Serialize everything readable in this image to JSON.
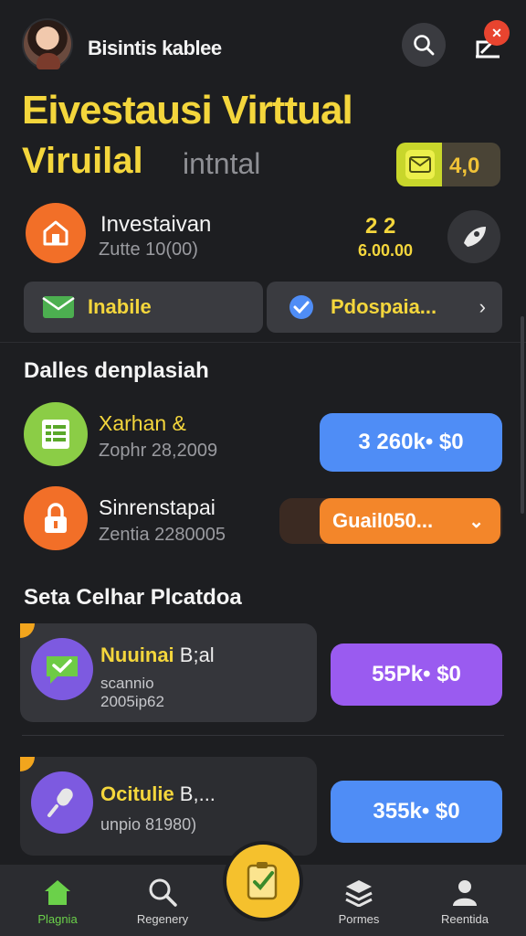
{
  "header": {
    "account_name": "Bisintis kablee",
    "notification_badge": "✕"
  },
  "hero": {
    "title_line1": "Eivestausi  Virttual",
    "title_line2": "Viruilal",
    "title_line2_sub": "intntal",
    "balance_value": "4,0"
  },
  "investment": {
    "title": "Investaivan",
    "subtitle": "Zutte 10(00)",
    "value_top": "2 2",
    "value_bottom": "6.00.00"
  },
  "quick_actions": {
    "left_label": "Inabile",
    "right_label": "Pdospaia..."
  },
  "section1": {
    "title": "Dalles denplasiah",
    "rows": [
      {
        "name": "Xarhan &",
        "sub": "Zophr 28,2009",
        "button": "3  260k•  $0"
      },
      {
        "name": "Sinrenstapai",
        "sub": "Zentia 2280005",
        "button": "Guail050..."
      }
    ]
  },
  "section2": {
    "title": "Seta Celhar Plcatdoa",
    "cards": [
      {
        "name": "Nuuinai",
        "name_tail": " B;al",
        "sub1": "scannio",
        "sub2": "2005ip62",
        "button": "55Pk•  $0"
      },
      {
        "name": "Ocitulie",
        "name_tail": " B,...",
        "sub1": "unpio 81980)",
        "button": "355k•  $0"
      }
    ]
  },
  "bottom_nav": {
    "home": "Plagnia",
    "search": "Regenery",
    "forms": "Pormes",
    "account": "Reentida"
  },
  "colors": {
    "background": "#1d1e21",
    "accent_yellow": "#f4d63c",
    "orange": "#f26f28",
    "blue": "#4f8df6",
    "purple": "#9a5bf0",
    "green": "#6bd14a"
  }
}
